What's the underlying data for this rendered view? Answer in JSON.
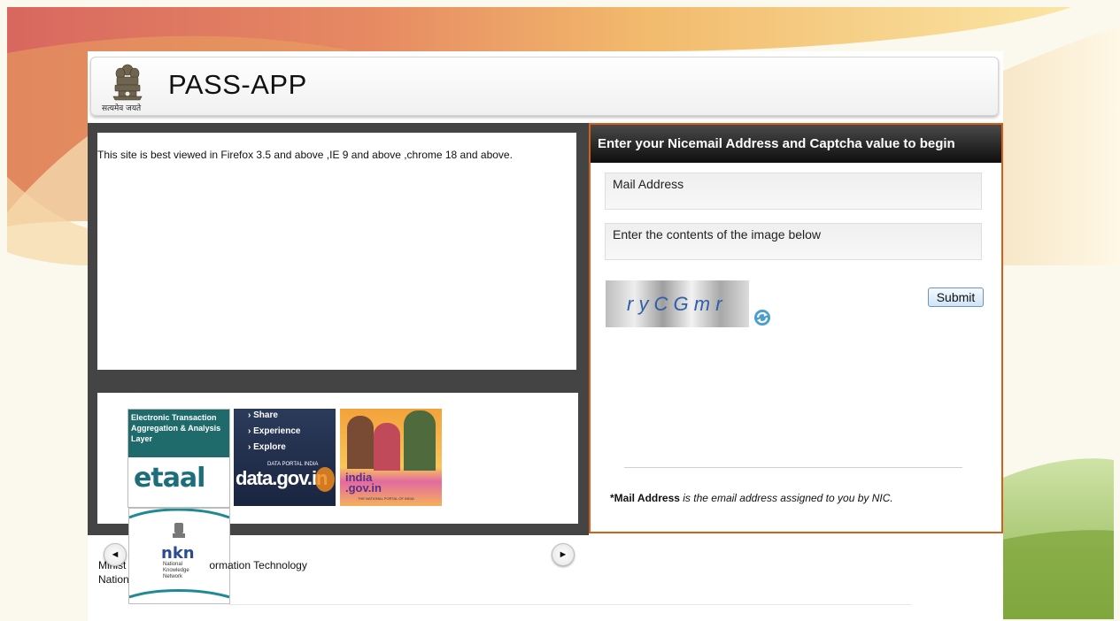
{
  "header": {
    "title": "PASS-APP",
    "emblem_caption": "सत्यमेव जयते"
  },
  "notice": {
    "text": "This site is best viewed in Firefox 3.5 and above ,IE 9 and above ,chrome 18 and above."
  },
  "banners": {
    "etaal": {
      "caption": "Electronic Transaction Aggregation & Analysis Layer",
      "logo": "etaal"
    },
    "datagov": {
      "bullets": [
        "› Share",
        "› Experience",
        "› Explore"
      ],
      "portal_label": "DATA PORTAL INDIA",
      "logo": "data.gov.in"
    },
    "indiagov": {
      "logo_line1": "india",
      "logo_line2": ".gov.in",
      "tagline": "THE NATIONAL PORTAL OF INDIA"
    },
    "nkn": {
      "logo": "nkn",
      "lines": [
        "National",
        "Knowledge",
        "Network"
      ]
    }
  },
  "login": {
    "heading": "Enter your Nicemail Address and Captcha value to begin",
    "mail_placeholder": "Mail Address",
    "captcha_placeholder": "Enter the contents of the image below",
    "captcha_text": "r y C G m r",
    "submit_label": "Submit",
    "note_bold": "*Mail Address",
    "note_rest": " is the email address assigned to you by NIC."
  },
  "footer": {
    "line1_start": "Minist",
    "line1_end": "ormation Technology",
    "line2": "Nation"
  },
  "colors": {
    "login_border": "#d35f1a",
    "dark_panel": "#444444",
    "header_bar": "#111111"
  },
  "icons": [
    "emblem-icon",
    "refresh-icon",
    "prev-arrow-icon",
    "next-arrow-icon"
  ]
}
